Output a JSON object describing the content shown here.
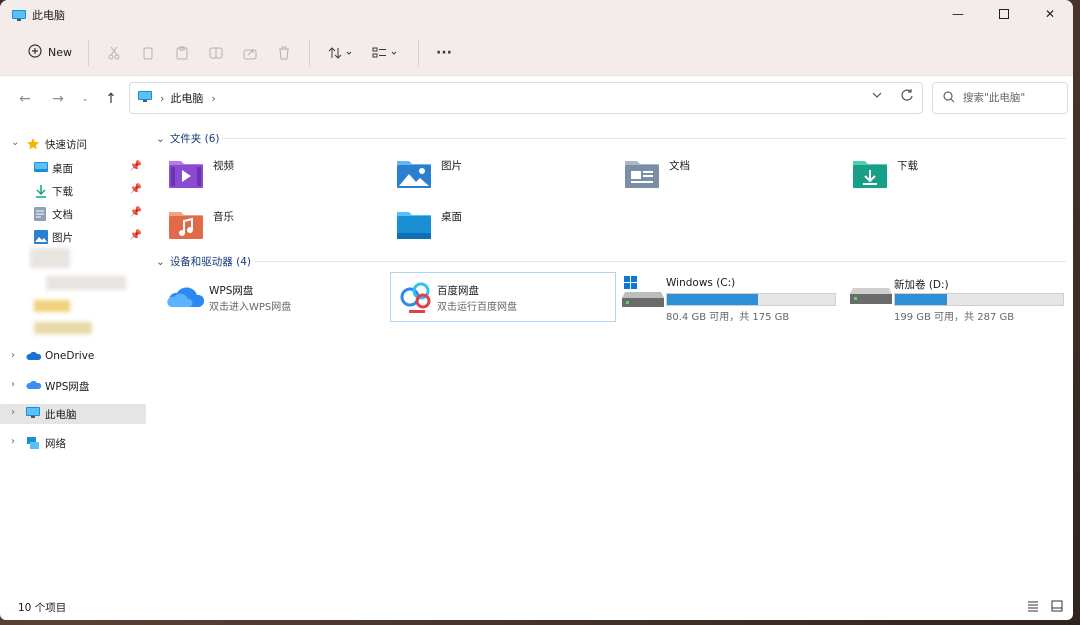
{
  "window": {
    "title": "此电脑",
    "minimize": "—",
    "maximize": "☐",
    "close": "✕"
  },
  "toolbar": {
    "new_label": "New",
    "items": [
      "cut-icon",
      "copy-icon",
      "paste-icon",
      "rename-icon",
      "share-icon",
      "delete-icon",
      "sort-icon",
      "view-icon",
      "more-icon"
    ],
    "more_label": "···"
  },
  "address": {
    "crumbs": [
      "此电脑"
    ],
    "separator": "›",
    "search_placeholder": "搜索\"此电脑\""
  },
  "sidebar": {
    "quick_access": "快速访问",
    "items": [
      {
        "label": "桌面",
        "icon": "desktop-icon",
        "pinned": true
      },
      {
        "label": "下载",
        "icon": "download-icon",
        "pinned": true
      },
      {
        "label": "文档",
        "icon": "document-icon",
        "pinned": true
      },
      {
        "label": "图片",
        "icon": "picture-icon",
        "pinned": true
      }
    ],
    "roots": [
      {
        "label": "OneDrive",
        "icon": "onedrive-icon",
        "selected": false
      },
      {
        "label": "WPS网盘",
        "icon": "wps-cloud-icon",
        "selected": false
      },
      {
        "label": "此电脑",
        "icon": "pc-icon",
        "selected": true
      },
      {
        "label": "网络",
        "icon": "network-icon",
        "selected": false
      }
    ]
  },
  "folders_group": {
    "title": "文件夹 (6)"
  },
  "folders": [
    {
      "label": "视频",
      "icon": "video-folder-icon",
      "color": "#8a4bd1"
    },
    {
      "label": "图片",
      "icon": "picture-folder-icon",
      "color": "#2b7fd1"
    },
    {
      "label": "文档",
      "icon": "document-folder-icon",
      "color": "#7a8ea8"
    },
    {
      "label": "下载",
      "icon": "download-folder-icon",
      "color": "#17a085"
    },
    {
      "label": "音乐",
      "icon": "music-folder-icon",
      "color": "#e06a4a"
    },
    {
      "label": "桌面",
      "icon": "desktop-folder-icon",
      "color": "#1b8fd6"
    }
  ],
  "devices_group": {
    "title": "设备和驱动器 (4)"
  },
  "devices": [
    {
      "name": "WPS网盘",
      "sub": "双击进入WPS网盘",
      "icon": "wps-cloud-icon"
    },
    {
      "name": "百度网盘",
      "sub": "双击运行百度网盘",
      "icon": "baidu-cloud-icon",
      "selected": true
    }
  ],
  "disks": [
    {
      "name": "Windows (C:)",
      "sub": "80.4 GB 可用，共 175 GB",
      "used_fraction": 0.54,
      "icon": "windows-drive-icon"
    },
    {
      "name": "新加卷 (D:)",
      "sub": "199 GB 可用，共 287 GB",
      "used_fraction": 0.31,
      "icon": "hard-drive-icon"
    }
  ],
  "status": {
    "count": "10 个项目"
  },
  "colors": {
    "accent": "#2d8fd5",
    "selection_border": "#b3d4ee",
    "group_title": "#1a3a7a"
  }
}
